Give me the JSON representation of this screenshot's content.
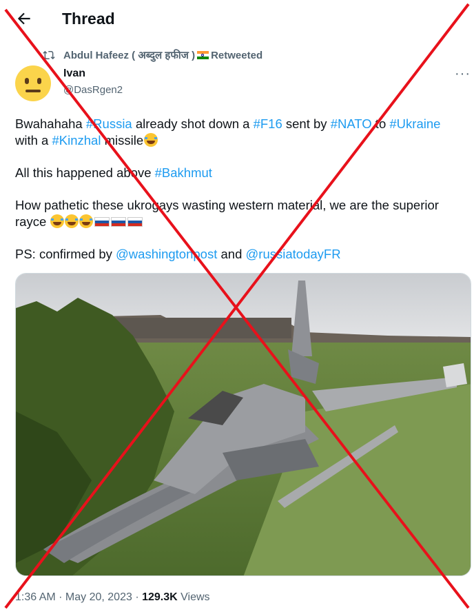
{
  "header": {
    "title": "Thread"
  },
  "retweet": {
    "label": "Abdul Hafeez ( अब्दुल हफीज ) 🇮🇳 Retweeted",
    "name": "Abdul Hafeez ( अब्दुल हफीज )",
    "suffix": "Retweeted"
  },
  "author": {
    "name": "Ivan",
    "handle": "@DasRgen2"
  },
  "tweet": {
    "p1": [
      {
        "t": "Bwahahaha ",
        "link": false
      },
      {
        "t": "#Russia",
        "link": true
      },
      {
        "t": " already shot down a ",
        "link": false
      },
      {
        "t": "#F16",
        "link": true
      },
      {
        "t": " sent by ",
        "link": false
      },
      {
        "t": "#NATO",
        "link": true
      },
      {
        "t": " to ",
        "link": false
      },
      {
        "t": "#Ukraine",
        "link": true
      },
      {
        "t": " with a ",
        "link": false
      },
      {
        "t": "#Kinzhal",
        "link": true
      },
      {
        "t": " missile",
        "link": false
      }
    ],
    "p2_text": "All this happened above ",
    "p2_link": "#Bakhmut",
    "p3": "How pathetic these ukrogays wasting western material, we are the superior rayce",
    "p4_text": "PS: confirmed by ",
    "p4_link1": "@washingtonpost",
    "p4_and": " and ",
    "p4_link2": "@russiatodayFR"
  },
  "meta": {
    "time": "1:36 AM · May 20, 2023 · ",
    "views_count": "129.3K",
    "views_label": " Views"
  },
  "icons": {
    "back": "arrow-left-icon",
    "retweet": "retweet-icon",
    "more": "more-horizontal-icon"
  },
  "colors": {
    "link": "#1d9bf0",
    "secondary": "#536471",
    "cross": "#e8111b"
  }
}
